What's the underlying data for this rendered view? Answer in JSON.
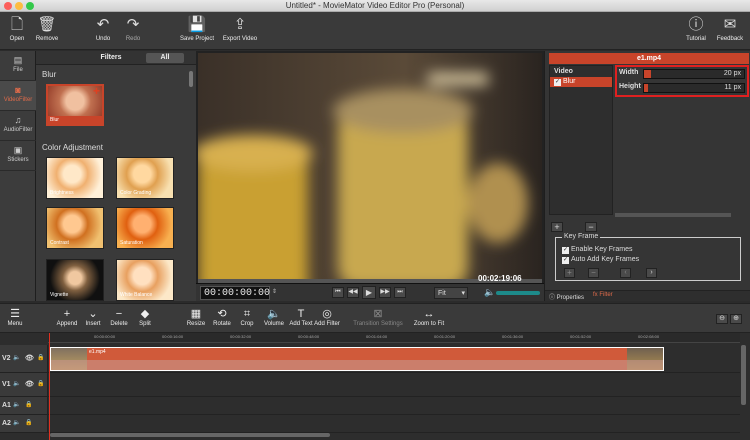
{
  "window": {
    "title": "Untitled* - MovieMator Video Editor Pro (Personal)"
  },
  "toolbar": {
    "open": "Open",
    "remove": "Remove",
    "undo": "Undo",
    "redo": "Redo",
    "save_project": "Save Project",
    "export_video": "Export Video",
    "tutorial": "Tutorial",
    "feedback": "Feedback"
  },
  "leftnav": {
    "file": "File",
    "videofilter": "VideoFilter",
    "audiofilter": "AudioFilter",
    "stickers": "Stickers"
  },
  "filters": {
    "tab_filters": "Filters",
    "tab_all": "All",
    "section_blur": "Blur",
    "blur": "Blur",
    "section_color": "Color Adjustment",
    "brightness": "Brightness",
    "color_grading": "Color Grading",
    "contrast": "Contrast",
    "saturation": "Saturation",
    "vignette": "Vignette",
    "white_balance": "White Balance"
  },
  "preview": {
    "elapsed": "00:00:00:00",
    "total": "00:02:19:06",
    "zoom": "Fit"
  },
  "properties": {
    "clip_name": "e1.mp4",
    "video_label": "Video",
    "blur_label": "Blur",
    "width_label": "Width",
    "width_value": "20 px",
    "width_level": 0.07,
    "height_label": "Height",
    "height_value": "11 px",
    "height_level": 0.04,
    "keyframe_title": "Key Frame",
    "enable_keyframes": "Enable Key Frames",
    "auto_add_keyframes": "Auto Add Key Frames",
    "tab_properties": "Properties",
    "tab_filter": "Filter"
  },
  "timeline_toolbar": {
    "menu": "Menu",
    "append": "Append",
    "insert": "Insert",
    "delete": "Delete",
    "split": "Split",
    "resize": "Resize",
    "rotate": "Rotate",
    "crop": "Crop",
    "volume": "Volume",
    "add_text": "Add Text",
    "add_filter": "Add Filter",
    "transition_settings": "Transition Settings",
    "zoom_to_fit": "Zoom to Fit"
  },
  "ruler": [
    "00:00:00:00",
    "00:00:16:00",
    "00:00:32:00",
    "00:00:48:00",
    "00:01:04:00",
    "00:01:20:00",
    "00:01:36:00",
    "00:01:52:00",
    "00:02:08:00"
  ],
  "tracks": {
    "v2": "V2",
    "v1": "V1",
    "a1": "A1",
    "a2": "A2",
    "clip": "e1.mp4"
  },
  "colors": {
    "accent": "#c8442a",
    "panel": "#3a3a3a"
  }
}
